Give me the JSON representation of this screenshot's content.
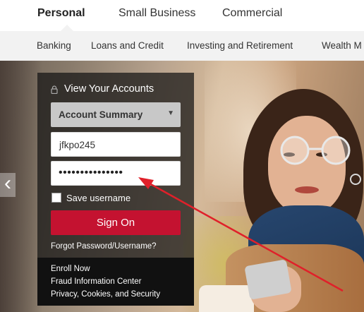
{
  "top_nav": {
    "tabs": [
      {
        "label": "Personal"
      },
      {
        "label": "Small Business"
      },
      {
        "label": "Commercial"
      }
    ]
  },
  "sub_nav": {
    "items": [
      {
        "label": "Banking"
      },
      {
        "label": "Loans and Credit"
      },
      {
        "label": "Investing and Retirement"
      },
      {
        "label": "Wealth M"
      }
    ]
  },
  "login": {
    "title": "View Your Accounts",
    "account_select": "Account Summary",
    "username": "jfkpo245",
    "password_mask": "•••••••••••••••",
    "save_username_label": "Save username",
    "sign_on_label": "Sign On",
    "forgot_label": "Forgot Password/Username?"
  },
  "footer_links": [
    {
      "label": "Enroll Now"
    },
    {
      "label": "Fraud Information Center"
    },
    {
      "label": "Privacy, Cookies, and Security"
    }
  ],
  "icons": {
    "lock": "lock-icon",
    "dropdown": "chevron-down-icon",
    "prev": "chevron-left-icon"
  },
  "colors": {
    "accent": "#c41230",
    "arrow": "#e0202a"
  }
}
